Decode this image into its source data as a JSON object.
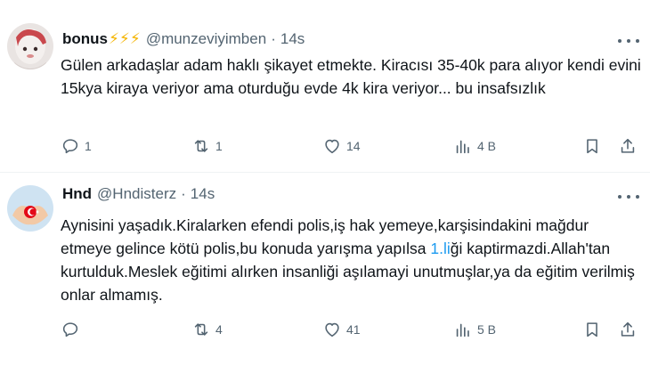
{
  "tweets": [
    {
      "author": {
        "name": "bonus",
        "badges": "⚡⚡⚡",
        "handle": "@munzeviyimben",
        "time": "14s"
      },
      "text": "Gülen arkadaşlar adam haklı şikayet etmekte. Kiracısı 35-40k para alıyor kendi evini 15kya kiraya veriyor ama oturduğu evde 4k kira veriyor... bu insafsızlık",
      "counts": {
        "replies": "1",
        "reposts": "1",
        "likes": "14",
        "views": "4 B"
      }
    },
    {
      "author": {
        "name": "Hnd",
        "handle": "@Hndisterz",
        "time": "14s"
      },
      "text_before": "Aynisini  yaşadık.Kiralarken efendi polis,iş hak yemeye,karşisindakini mağdur etmeye gelince kötü polis,bu konuda yarışma yapılsa ",
      "text_link": "1.li",
      "text_after": "ği kaptirmazdi.Allah'tan kurtulduk.Meslek eğitimi alırken insanliği aşılamayi unutmuşlar,ya da eğitim verilmiş onlar almamış.",
      "counts": {
        "replies": "",
        "reposts": "4",
        "likes": "41",
        "views": "5 B"
      }
    }
  ],
  "icons": {
    "reply": "reply-icon",
    "repost": "repost-icon",
    "like": "heart-icon",
    "views": "views-icon",
    "bookmark": "bookmark-icon",
    "share": "share-icon",
    "more": "more-icon"
  },
  "colors": {
    "text": "#0f1419",
    "secondary": "#536471",
    "link": "#1d9bf0",
    "divider": "#eff3f4",
    "bolt": "#f4b400"
  }
}
